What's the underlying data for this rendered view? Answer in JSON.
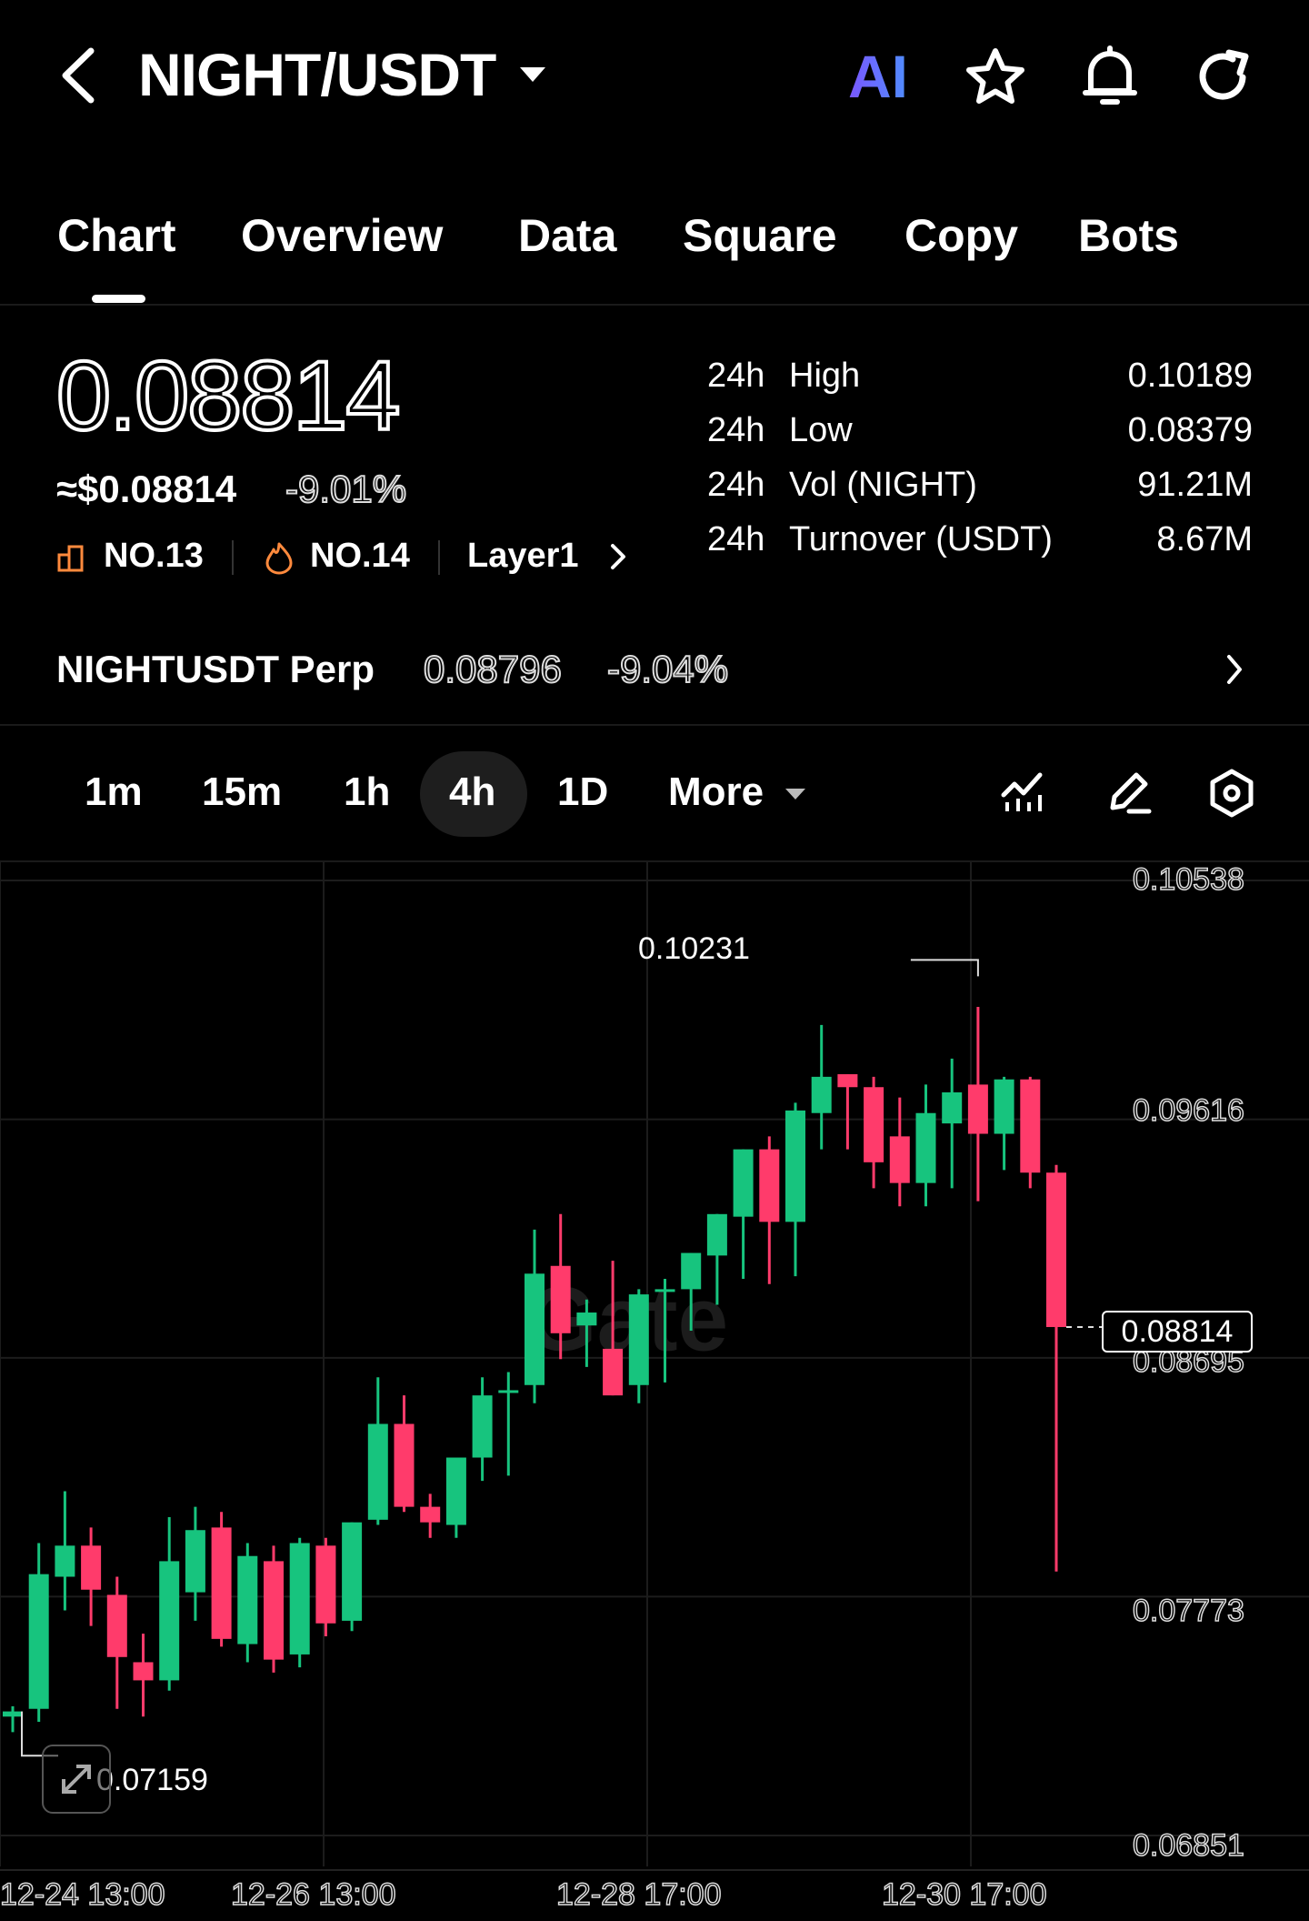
{
  "header": {
    "title": "NIGHT/USDT",
    "ai_label": "AI",
    "icons": [
      "back-icon",
      "dropdown-caret-icon",
      "ai-icon",
      "star-icon",
      "bell-icon",
      "refresh-icon"
    ]
  },
  "tabs": [
    "Chart",
    "Overview",
    "Data",
    "Square",
    "Copy",
    "Bots"
  ],
  "active_tab": "Chart",
  "ticker": {
    "price": "0.08814",
    "usd_price": "≈$0.08814",
    "change": "-9.01%",
    "rank1": "NO.13",
    "rank2": "NO.14",
    "sector": "Layer1"
  },
  "stats": [
    {
      "period": "24h",
      "label": "High",
      "value": "0.10189"
    },
    {
      "period": "24h",
      "label": "Low",
      "value": "0.08379"
    },
    {
      "period": "24h",
      "label": "Vol (NIGHT)",
      "value": "91.21M"
    },
    {
      "period": "24h",
      "label": "Turnover (USDT)",
      "value": "8.67M"
    }
  ],
  "perp": {
    "name": "NIGHTUSDT Perp",
    "price": "0.08796",
    "change": "-9.04%"
  },
  "timeframes": {
    "items": [
      "1m",
      "15m",
      "1h",
      "4h",
      "1D"
    ],
    "active": "4h",
    "more_label": "More"
  },
  "chart_data": {
    "type": "candlestick",
    "y_axis_labels": [
      "0.10538",
      "0.09616",
      "0.08695",
      "0.07773",
      "0.06851"
    ],
    "x_axis_labels": [
      "12-24 13:00",
      "12-26 13:00",
      "12-28 17:00",
      "12-30 17:00"
    ],
    "max_marker": "0.10231",
    "min_marker": "0.07159",
    "current_price": "0.08814",
    "watermark": "Gate",
    "candles": [
      {
        "o": 0.0731,
        "h": 0.0735,
        "l": 0.0725,
        "c": 0.0733
      },
      {
        "o": 0.0734,
        "h": 0.0798,
        "l": 0.0729,
        "c": 0.0786
      },
      {
        "o": 0.0785,
        "h": 0.0818,
        "l": 0.0772,
        "c": 0.0797
      },
      {
        "o": 0.0797,
        "h": 0.0804,
        "l": 0.0766,
        "c": 0.078
      },
      {
        "o": 0.0778,
        "h": 0.0785,
        "l": 0.0734,
        "c": 0.0754
      },
      {
        "o": 0.0752,
        "h": 0.0763,
        "l": 0.0731,
        "c": 0.0745
      },
      {
        "o": 0.0745,
        "h": 0.0808,
        "l": 0.0741,
        "c": 0.0791
      },
      {
        "o": 0.0779,
        "h": 0.0812,
        "l": 0.0768,
        "c": 0.0803
      },
      {
        "o": 0.0804,
        "h": 0.081,
        "l": 0.0758,
        "c": 0.0761
      },
      {
        "o": 0.0759,
        "h": 0.0798,
        "l": 0.0752,
        "c": 0.0793
      },
      {
        "o": 0.0791,
        "h": 0.0797,
        "l": 0.0748,
        "c": 0.0753
      },
      {
        "o": 0.0755,
        "h": 0.08,
        "l": 0.075,
        "c": 0.0798
      },
      {
        "o": 0.0797,
        "h": 0.08,
        "l": 0.0762,
        "c": 0.0767
      },
      {
        "o": 0.0768,
        "h": 0.0806,
        "l": 0.0764,
        "c": 0.0806
      },
      {
        "o": 0.0807,
        "h": 0.0862,
        "l": 0.0805,
        "c": 0.0844
      },
      {
        "o": 0.0844,
        "h": 0.0855,
        "l": 0.081,
        "c": 0.0812
      },
      {
        "o": 0.0812,
        "h": 0.0817,
        "l": 0.08,
        "c": 0.0806
      },
      {
        "o": 0.0805,
        "h": 0.083,
        "l": 0.08,
        "c": 0.0831
      },
      {
        "o": 0.0831,
        "h": 0.0862,
        "l": 0.0822,
        "c": 0.0855
      },
      {
        "o": 0.0856,
        "h": 0.0864,
        "l": 0.0824,
        "c": 0.0857
      },
      {
        "o": 0.0859,
        "h": 0.0919,
        "l": 0.0852,
        "c": 0.0902
      },
      {
        "o": 0.0905,
        "h": 0.0925,
        "l": 0.0869,
        "c": 0.0879
      },
      {
        "o": 0.0882,
        "h": 0.0892,
        "l": 0.0866,
        "c": 0.0887
      },
      {
        "o": 0.0873,
        "h": 0.0907,
        "l": 0.0865,
        "c": 0.0855
      },
      {
        "o": 0.0859,
        "h": 0.0896,
        "l": 0.0852,
        "c": 0.0894
      },
      {
        "o": 0.0895,
        "h": 0.09,
        "l": 0.086,
        "c": 0.0896
      },
      {
        "o": 0.0896,
        "h": 0.091,
        "l": 0.088,
        "c": 0.091
      },
      {
        "o": 0.0909,
        "h": 0.0925,
        "l": 0.089,
        "c": 0.0925
      },
      {
        "o": 0.0924,
        "h": 0.095,
        "l": 0.09,
        "c": 0.095
      },
      {
        "o": 0.095,
        "h": 0.0955,
        "l": 0.0898,
        "c": 0.0922
      },
      {
        "o": 0.0922,
        "h": 0.0968,
        "l": 0.0901,
        "c": 0.0965
      },
      {
        "o": 0.0964,
        "h": 0.0998,
        "l": 0.095,
        "c": 0.0978
      },
      {
        "o": 0.0979,
        "h": 0.0972,
        "l": 0.095,
        "c": 0.0974
      },
      {
        "o": 0.0974,
        "h": 0.0978,
        "l": 0.0935,
        "c": 0.0945
      },
      {
        "o": 0.0955,
        "h": 0.097,
        "l": 0.0928,
        "c": 0.0937
      },
      {
        "o": 0.0937,
        "h": 0.0975,
        "l": 0.0928,
        "c": 0.0964
      },
      {
        "o": 0.096,
        "h": 0.0985,
        "l": 0.0935,
        "c": 0.0972
      },
      {
        "o": 0.0975,
        "h": 0.1005,
        "l": 0.093,
        "c": 0.0956
      },
      {
        "o": 0.0956,
        "h": 0.0978,
        "l": 0.0942,
        "c": 0.0977
      },
      {
        "o": 0.0977,
        "h": 0.0978,
        "l": 0.0935,
        "c": 0.0941
      },
      {
        "o": 0.0941,
        "h": 0.0944,
        "l": 0.0787,
        "c": 0.08814
      }
    ],
    "ylim": [
      0.06851,
      0.10538
    ],
    "colors": {
      "up": "#17c47e",
      "down": "#ff3b6b",
      "grid": "#1c1c1c"
    }
  }
}
